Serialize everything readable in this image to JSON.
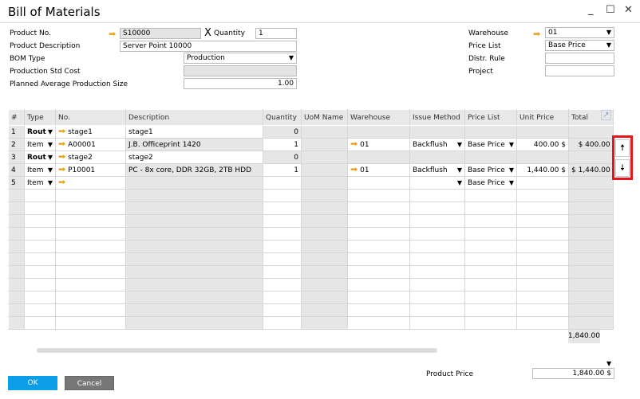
{
  "window": {
    "title": "Bill of Materials",
    "minimize": "_",
    "maximize": "☐",
    "close": "✕"
  },
  "header": {
    "product_no_label": "Product No.",
    "product_no": "S10000",
    "quantity_label": "Quantity",
    "quantity": "1",
    "x_mark": "X",
    "product_desc_label": "Product Description",
    "product_desc": "Server Point 10000",
    "bom_type_label": "BOM Type",
    "bom_type": "Production",
    "std_cost_label": "Production Std Cost",
    "std_cost": "",
    "planned_size_label": "Planned Average Production Size",
    "planned_size": "1.00",
    "warehouse_label": "Warehouse",
    "warehouse": "01",
    "price_list_label": "Price List",
    "price_list": "Base Price",
    "distr_rule_label": "Distr. Rule",
    "distr_rule": "",
    "project_label": "Project",
    "project": ""
  },
  "grid": {
    "columns": [
      "#",
      "Type",
      "No.",
      "Description",
      "Quantity",
      "UoM Name",
      "Warehouse",
      "Issue Method",
      "Price List",
      "Unit Price",
      "Total"
    ],
    "rows": [
      {
        "num": "1",
        "type": "Rout",
        "no": "stage1",
        "desc": "stage1",
        "qty": "0",
        "uom": "",
        "wh": "",
        "issue": "",
        "pl": "",
        "price": "",
        "total": ""
      },
      {
        "num": "2",
        "type": "Item",
        "no": "A00001",
        "desc": "J.B. Officeprint 1420",
        "qty": "1",
        "uom": "",
        "wh": "01",
        "issue": "Backflush",
        "pl": "Base Price",
        "price": "400.00 $",
        "total": "400.00 $"
      },
      {
        "num": "3",
        "type": "Rout",
        "no": "stage2",
        "desc": "stage2",
        "qty": "0",
        "uom": "",
        "wh": "",
        "issue": "",
        "pl": "",
        "price": "",
        "total": ""
      },
      {
        "num": "4",
        "type": "Item",
        "no": "P10001",
        "desc": "PC - 8x core, DDR 32GB, 2TB HDD",
        "qty": "1",
        "uom": "",
        "wh": "01",
        "issue": "Backflush",
        "pl": "Base Price",
        "price": "1,440.00 $",
        "total": "1,440.00 $"
      },
      {
        "num": "5",
        "type": "Item",
        "no": "",
        "desc": "",
        "qty": "",
        "uom": "",
        "wh": "",
        "issue": "",
        "pl": "Base Price",
        "price": "",
        "total": ""
      }
    ],
    "total_footer": "1,840.00 $"
  },
  "footer": {
    "product_price_label": "Product Price",
    "product_price": "1,840.00 $",
    "ok": "OK",
    "cancel": "Cancel"
  },
  "colors": {
    "ok": "#0b9ee6",
    "cancel": "#777777",
    "highlight": "#e8141c",
    "arrow": "#e9a31b"
  }
}
